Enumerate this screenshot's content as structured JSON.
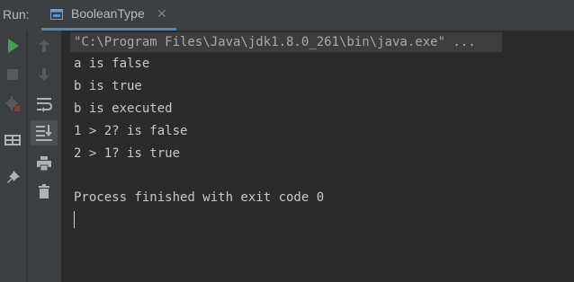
{
  "run_label": "Run:",
  "tab": {
    "title": "BooleanType",
    "close": "✕"
  },
  "toolbar_left": [
    {
      "name": "run-icon",
      "color": "#499c54"
    },
    {
      "name": "stop-icon",
      "color": "#5a5a5a"
    },
    {
      "name": "debug-settings-icon",
      "color": "#5a5a5a"
    },
    {
      "name": "layout-icon",
      "color": "#afb1b3"
    },
    {
      "name": "pin-icon",
      "color": "#afb1b3"
    }
  ],
  "toolbar_right": [
    {
      "name": "arrow-up-icon"
    },
    {
      "name": "arrow-down-icon"
    },
    {
      "name": "soft-wrap-icon"
    },
    {
      "name": "scroll-to-end-icon"
    },
    {
      "name": "print-icon"
    },
    {
      "name": "trash-icon"
    }
  ],
  "console": {
    "command": "\"C:\\Program Files\\Java\\jdk1.8.0_261\\bin\\java.exe\" ...",
    "lines": [
      "a is false",
      "b is true",
      "b is executed",
      "1 > 2? is false",
      "2 > 1? is true",
      "",
      "Process finished with exit code 0"
    ]
  },
  "colors": {
    "accent": "#4a88c7",
    "background": "#2b2b2b",
    "toolbar": "#3c3f41",
    "text": "#c8c8c8"
  }
}
